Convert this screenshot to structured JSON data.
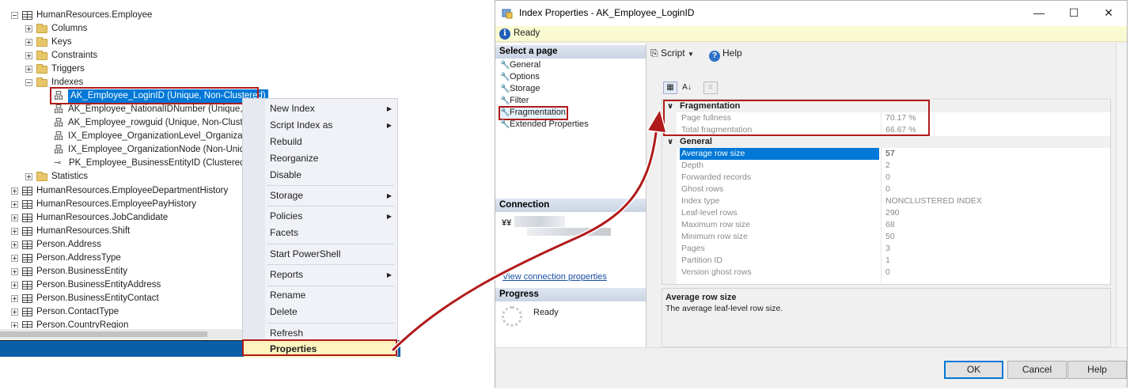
{
  "explorer": {
    "nodes": [
      {
        "label": "HumanResources.Employee"
      },
      {
        "label": "Columns"
      },
      {
        "label": "Keys"
      },
      {
        "label": "Constraints"
      },
      {
        "label": "Triggers"
      },
      {
        "label": "Indexes"
      },
      {
        "label": "AK_Employee_LoginID (Unique, Non-Clustered)"
      },
      {
        "label": "AK_Employee_NationalIDNumber (Unique, N"
      },
      {
        "label": "AK_Employee_rowguid (Unique, Non-Cluste"
      },
      {
        "label": "IX_Employee_OrganizationLevel_Organizatio"
      },
      {
        "label": "IX_Employee_OrganizationNode (Non-Uniqu"
      },
      {
        "label": "PK_Employee_BusinessEntityID (Clustered)"
      },
      {
        "label": "Statistics"
      },
      {
        "label": "HumanResources.EmployeeDepartmentHistory"
      },
      {
        "label": "HumanResources.EmployeePayHistory"
      },
      {
        "label": "HumanResources.JobCandidate"
      },
      {
        "label": "HumanResources.Shift"
      },
      {
        "label": "Person.Address"
      },
      {
        "label": "Person.AddressType"
      },
      {
        "label": "Person.BusinessEntity"
      },
      {
        "label": "Person.BusinessEntityAddress"
      },
      {
        "label": "Person.BusinessEntityContact"
      },
      {
        "label": "Person.ContactType"
      },
      {
        "label": "Person.CountryRegion"
      }
    ]
  },
  "context_menu": {
    "items": [
      {
        "label": "New Index"
      },
      {
        "label": "Script Index as"
      },
      {
        "label": "Rebuild"
      },
      {
        "label": "Reorganize"
      },
      {
        "label": "Disable"
      },
      {
        "label": "Storage"
      },
      {
        "label": "Policies"
      },
      {
        "label": "Facets"
      },
      {
        "label": "Start PowerShell"
      },
      {
        "label": "Reports"
      },
      {
        "label": "Rename"
      },
      {
        "label": "Delete"
      },
      {
        "label": "Refresh"
      },
      {
        "label": "Properties"
      }
    ]
  },
  "dialog": {
    "title": "Index Properties - AK_Employee_LoginID",
    "status": "Ready",
    "select_page_header": "Select a page",
    "pages": [
      {
        "label": "General"
      },
      {
        "label": "Options"
      },
      {
        "label": "Storage"
      },
      {
        "label": "Filter"
      },
      {
        "label": "Fragmentation"
      },
      {
        "label": "Extended Properties"
      }
    ],
    "connection_header": "Connection",
    "view_connection_label": "View connection properties",
    "progress_header": "Progress",
    "progress_status": "Ready",
    "toolbar": {
      "script_label": "Script",
      "help_label": "Help"
    },
    "categories": {
      "fragmentation": {
        "name": "Fragmentation",
        "rows": [
          {
            "name": "Page fullness",
            "value": "70.17 %"
          },
          {
            "name": "Total fragmentation",
            "value": "66.67 %"
          }
        ]
      },
      "general": {
        "name": "General",
        "rows": [
          {
            "name": "Average row size",
            "value": "57"
          },
          {
            "name": "Depth",
            "value": "2"
          },
          {
            "name": "Forwarded records",
            "value": "0"
          },
          {
            "name": "Ghost rows",
            "value": "0"
          },
          {
            "name": "Index type",
            "value": "NONCLUSTERED INDEX"
          },
          {
            "name": "Leaf-level rows",
            "value": "290"
          },
          {
            "name": "Maximum row size",
            "value": "68"
          },
          {
            "name": "Minimum row size",
            "value": "50"
          },
          {
            "name": "Pages",
            "value": "3"
          },
          {
            "name": "Partition ID",
            "value": "1"
          },
          {
            "name": "Version ghost rows",
            "value": "0"
          }
        ]
      }
    },
    "description": {
      "title": "Average row size",
      "text": "The average leaf-level row size."
    },
    "buttons": {
      "ok": "OK",
      "cancel": "Cancel",
      "help": "Help"
    }
  }
}
